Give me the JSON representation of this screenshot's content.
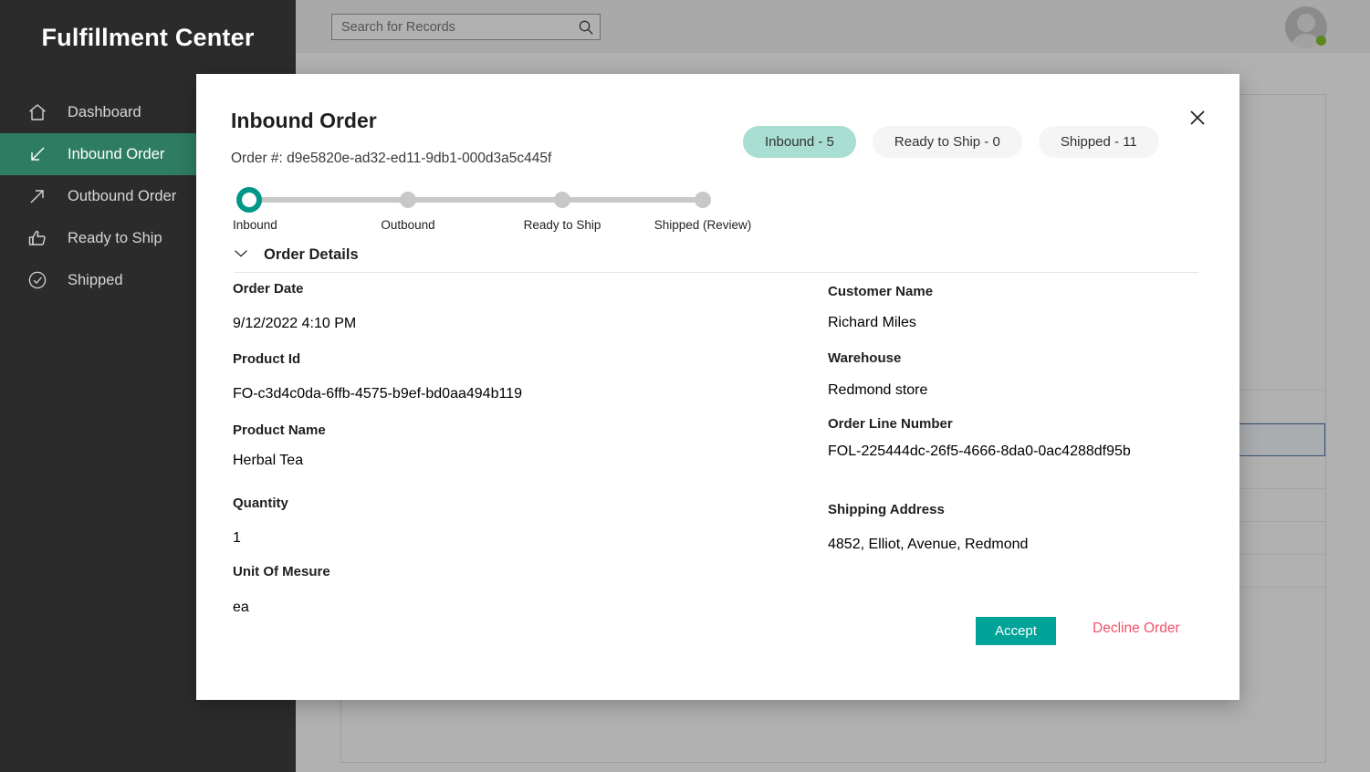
{
  "brand": {
    "title": "Fulfillment Center"
  },
  "search": {
    "placeholder": "Search for Records",
    "value": ""
  },
  "sidebar": {
    "items": [
      {
        "label": "Dashboard",
        "icon": "home-icon",
        "active": false
      },
      {
        "label": "Inbound Order",
        "icon": "arrow-inbound-icon",
        "active": true
      },
      {
        "label": "Outbound Order",
        "icon": "arrow-outbound-icon",
        "active": false
      },
      {
        "label": "Ready to Ship",
        "icon": "thumbs-up-icon",
        "active": false
      },
      {
        "label": "Shipped",
        "icon": "check-circle-icon",
        "active": false
      }
    ]
  },
  "modal": {
    "title": "Inbound Order",
    "order_number": "Order #: d9e5820e-ad32-ed11-9db1-000d3a5c445f",
    "close_label": "Close",
    "pills": [
      {
        "label": "Inbound - 5",
        "active": true
      },
      {
        "label": "Ready to Ship - 0",
        "active": false
      },
      {
        "label": "Shipped - 11",
        "active": false
      }
    ],
    "stepper": {
      "steps": [
        {
          "label": "Inbound",
          "state": "current"
        },
        {
          "label": "Outbound",
          "state": "pending"
        },
        {
          "label": "Ready to Ship",
          "state": "pending"
        },
        {
          "label": "Shipped (Review)",
          "state": "pending"
        }
      ]
    },
    "section": {
      "caption": "Order Details",
      "expanded": true
    },
    "fields_left": [
      {
        "label": "Order Date",
        "value": "9/12/2022 4:10 PM"
      },
      {
        "label": "Product Id",
        "value": "FO-c3d4c0da-6ffb-4575-b9ef-bd0aa494b119"
      },
      {
        "label": "Product Name",
        "value": "Herbal Tea"
      },
      {
        "label": "Quantity",
        "value": "1"
      },
      {
        "label": "Unit Of Mesure",
        "value": "ea"
      }
    ],
    "fields_right": [
      {
        "label": "Customer Name",
        "value": "Richard Miles"
      },
      {
        "label": "Warehouse",
        "value": "Redmond store"
      },
      {
        "label": "Order Line Number",
        "value": "FOL-225444dc-26f5-4666-8da0-0ac4288df95b"
      },
      {
        "label": "Shipping Address",
        "value": "4852, Elliot, Avenue, Redmond"
      }
    ],
    "accept_label": "Accept",
    "decline_label": "Decline Order"
  },
  "colors": {
    "sidebar_bg": "#2b2b2b",
    "nav_active": "#2e7d63",
    "accent_teal": "#00a398",
    "pill_active": "#a9ded2",
    "decline_red": "#f2536d",
    "status_online": "#6bb700",
    "row_selected_border": "#2b579a"
  }
}
